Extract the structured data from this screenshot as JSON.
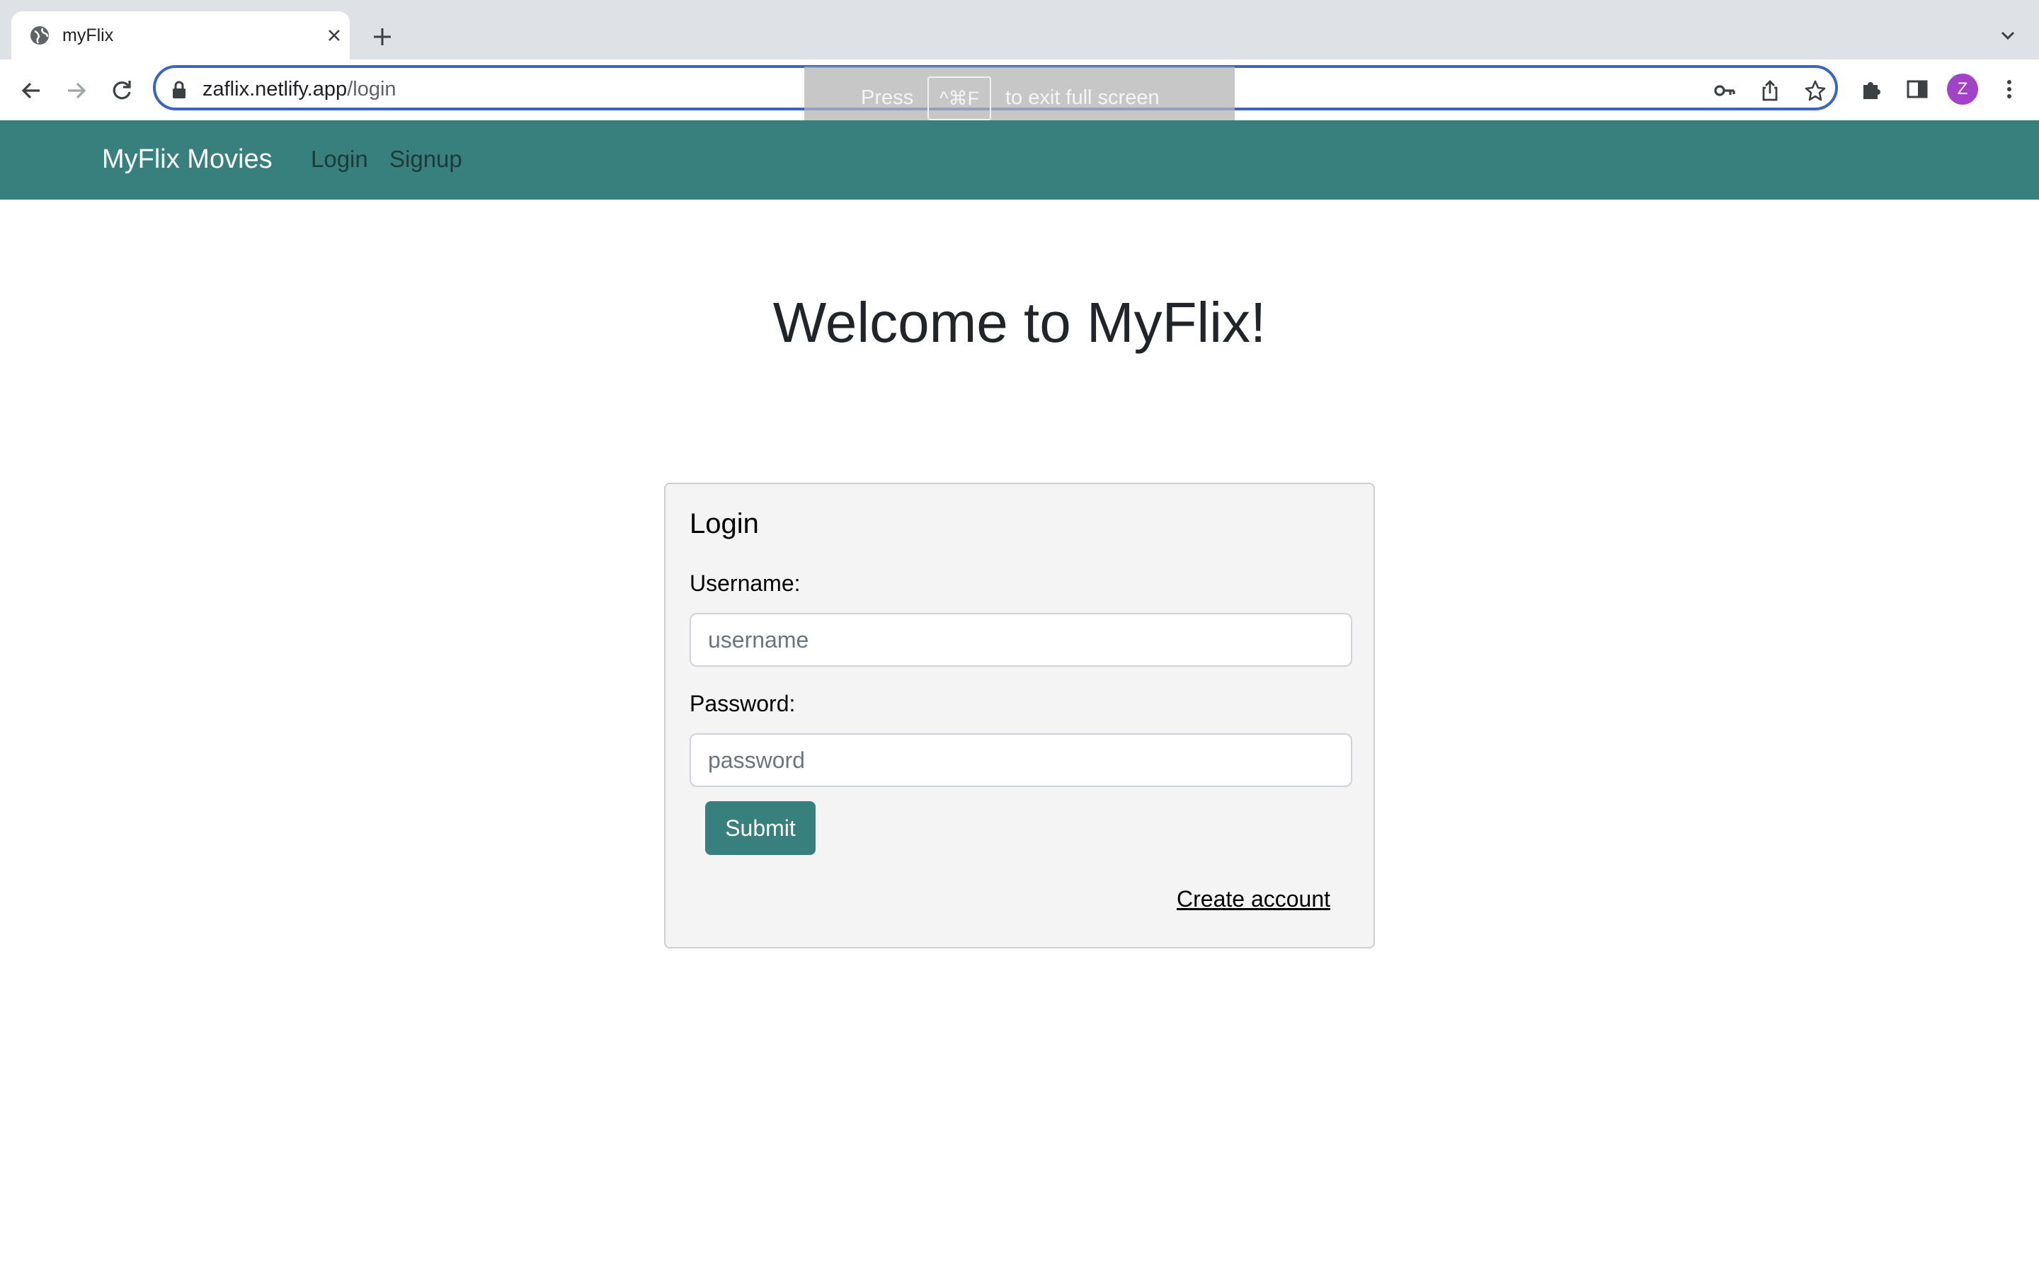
{
  "browser": {
    "tab_title": "myFlix",
    "url_host": "zaflix.netlify.app",
    "url_path": "/login",
    "profile_initial": "Z",
    "fullscreen_banner": {
      "prefix": "Press",
      "key": "^⌘F",
      "suffix": "to exit full screen"
    }
  },
  "navbar": {
    "brand": "MyFlix Movies",
    "links": [
      "Login",
      "Signup"
    ],
    "color": "#37807d"
  },
  "main": {
    "heading": "Welcome to MyFlix!"
  },
  "login_form": {
    "title": "Login",
    "username_label": "Username:",
    "username_placeholder": "username",
    "password_label": "Password:",
    "password_placeholder": "password",
    "submit_label": "Submit",
    "create_account_link": "Create account"
  }
}
